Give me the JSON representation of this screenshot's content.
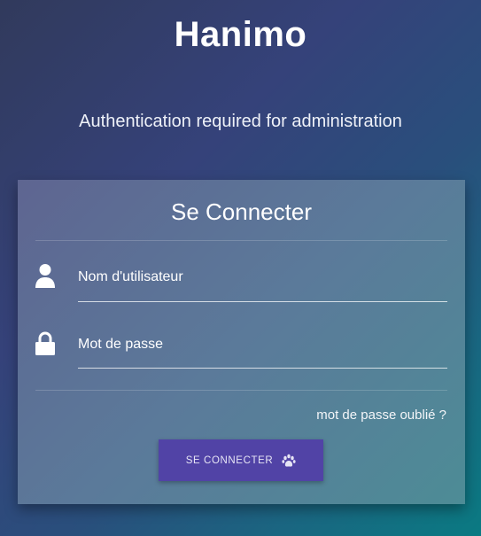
{
  "header": {
    "title": "Hanimo",
    "subtitle": "Authentication required for administration"
  },
  "login_card": {
    "title": "Se Connecter",
    "username": {
      "placeholder": "Nom d'utilisateur",
      "value": "",
      "icon": "user-icon"
    },
    "password": {
      "placeholder": "Mot de passe",
      "value": "",
      "icon": "lock-icon"
    },
    "forgot_password_label": "mot de passe oublié ?",
    "submit_label": "SE CONNECTER",
    "submit_icon": "paw-icon"
  },
  "colors": {
    "button": "#5143a6",
    "card": "#5b7a9a",
    "background_start": "#313a5c",
    "background_end": "#0a7a82"
  }
}
